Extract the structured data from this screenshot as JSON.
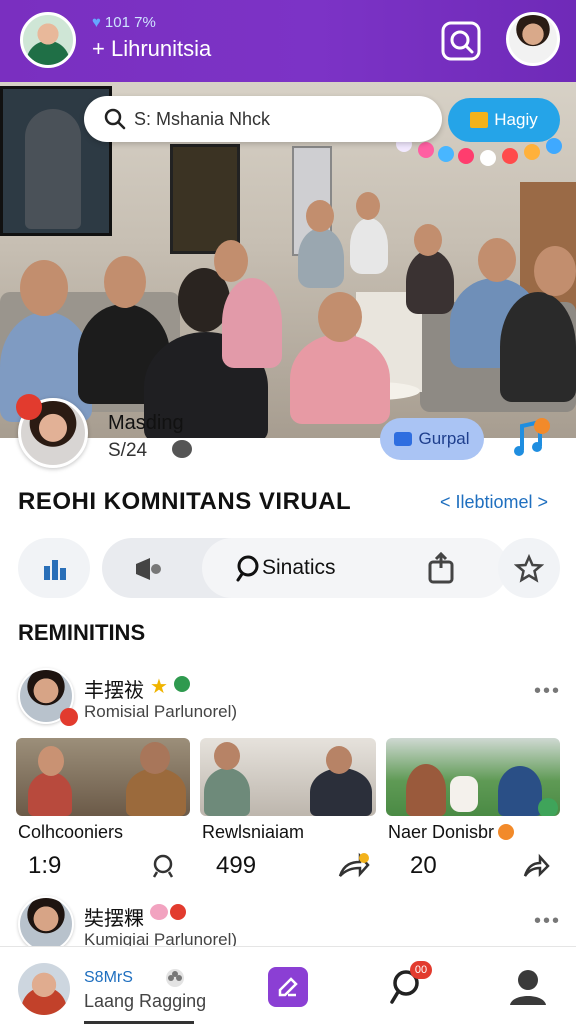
{
  "header": {
    "stats": "101 7%",
    "title": "+ Lihrunitsia"
  },
  "hero": {
    "search_placeholder": "S: Mshania Nhck",
    "happy_button": "Hagiy"
  },
  "host": {
    "name": "Masding",
    "time": "S/24",
    "goal_button": "Gurpal"
  },
  "section": {
    "title": "REOHI KOMNITANS VIRUAL",
    "link": "< Ilebtiomel >"
  },
  "actions": {
    "pill_label": "Sinatics"
  },
  "subsection_title": "REMINITINS",
  "feed": [
    {
      "name": "丰摆祓",
      "subtitle": "Romisial Parlunorel)"
    },
    {
      "name": "奘摆粿",
      "subtitle": "Kumigiai Parlunorel)"
    }
  ],
  "cards": [
    {
      "title": "Colhcooniers",
      "count": "1:9"
    },
    {
      "title": "Rewlsniaiam",
      "count": "499"
    },
    {
      "title": "Naer Donisbr",
      "count": "20"
    }
  ],
  "bottom_nav": {
    "name": "S8MrS",
    "status": "Laang Ragging",
    "badge": "00"
  },
  "colors": {
    "header_purple": "#7a2fc0",
    "accent_blue": "#25a4e8",
    "link_blue": "#1f6fbf",
    "badge_red": "#e23b2e"
  }
}
